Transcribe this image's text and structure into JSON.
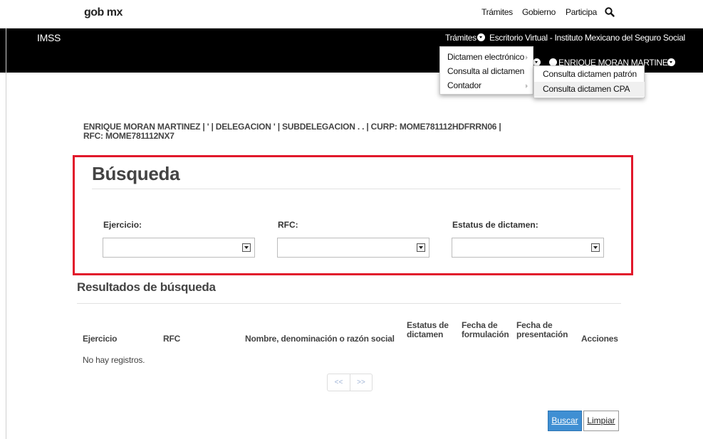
{
  "gob": {
    "logo": "gob mx",
    "nav": [
      "Trámites",
      "Gobierno",
      "Participa"
    ],
    "search_icon": "search-icon"
  },
  "header": {
    "brand": "IMSS",
    "tramites_label": "Trámites",
    "title": "Escritorio Virtual - Instituto Mexicano del Seguro Social",
    "user_name": "ENRIQUE MORAN MARTINEZ"
  },
  "menu": {
    "items": [
      {
        "label": "Dictamen electrónico"
      },
      {
        "label": "Consulta al dictamen"
      },
      {
        "label": "Contador"
      }
    ],
    "submenu": [
      {
        "label": "Consulta dictamen patrón"
      },
      {
        "label": "Consulta dictamen CPA"
      }
    ]
  },
  "user_info": {
    "line1": "ENRIQUE MORAN MARTINEZ | ' | DELEGACION '                     | SUBDELEGACION . .            | CURP: MOME781112HDFRRN06 |",
    "line2": "RFC: MOME781112NX7"
  },
  "search": {
    "title": "Búsqueda",
    "fields": [
      {
        "label": "Ejercicio:",
        "value": ""
      },
      {
        "label": "RFC:",
        "value": ""
      },
      {
        "label": "Estatus de dictamen:",
        "value": ""
      }
    ]
  },
  "results": {
    "title": "Resultados de búsqueda",
    "columns": [
      {
        "l1": "Ejercicio",
        "l2": ""
      },
      {
        "l1": "RFC",
        "l2": ""
      },
      {
        "l1": "Nombre, denominación o razón social",
        "l2": ""
      },
      {
        "l1": "Estatus de",
        "l2": "dictamen"
      },
      {
        "l1": "Fecha de",
        "l2": "formulación"
      },
      {
        "l1": "Fecha de",
        "l2": "presentación"
      },
      {
        "l1": "Acciones",
        "l2": ""
      }
    ],
    "empty_text": "No hay registros.",
    "pager": {
      "prev": "<<",
      "next": ">>"
    }
  },
  "actions": {
    "search_label": "Buscar",
    "clear_label": "Limpiar"
  },
  "colors": {
    "highlight_box": "#e1182b",
    "primary_button": "#3f8fd3",
    "header_bg": "#000000"
  }
}
